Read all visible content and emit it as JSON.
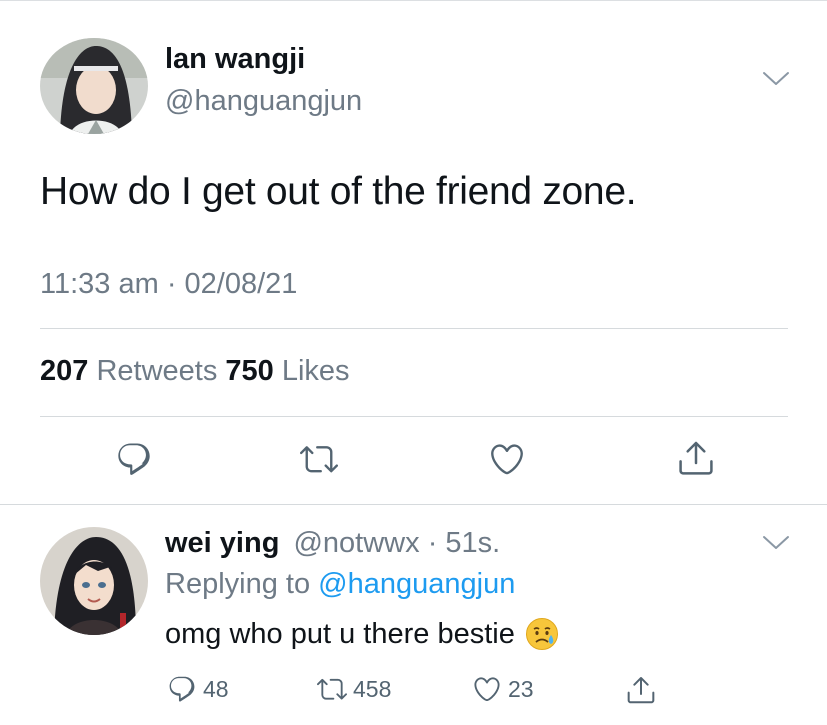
{
  "main_tweet": {
    "author_name": "lan wangji",
    "handle": "@hanguangjun",
    "text": "How do I get out of the friend zone.",
    "timestamp": "11:33 am · 02/08/21",
    "retweets_count": "207",
    "retweets_label": "Retweets",
    "likes_count": "750",
    "likes_label": "Likes",
    "actions": [
      "reply-icon",
      "retweet-icon",
      "like-icon",
      "share-icon"
    ]
  },
  "reply": {
    "author_name": "wei ying",
    "handle": "@notwwx",
    "time": "· 51s.",
    "replying_prefix": "Replying to",
    "replying_handle": "@hanguangjun",
    "text": "omg who put u there bestie",
    "emoji": "crying-face-emoji",
    "reply_count": "48",
    "retweet_count": "458",
    "like_count": "23"
  },
  "colors": {
    "text": "#0f1419",
    "muted": "#6e7a86",
    "link": "#1d9bf0",
    "divider": "#d6dadd",
    "icon": "#536471"
  }
}
